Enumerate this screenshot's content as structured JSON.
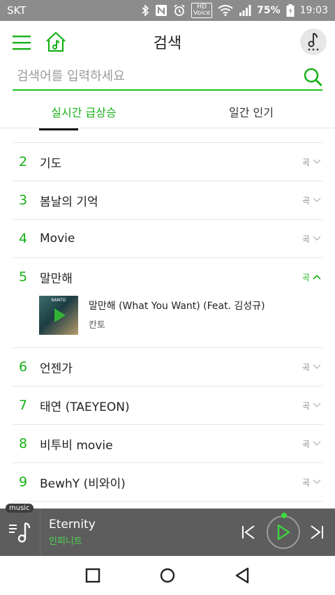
{
  "status_bar": {
    "carrier": "SKT",
    "battery": "75%",
    "time": "19:03",
    "hd_top": "HD",
    "hd_bottom": "Voice"
  },
  "header": {
    "title": "검색"
  },
  "search": {
    "placeholder": "검색어를 입력하세요"
  },
  "tabs": [
    {
      "label": "실시간 급상승",
      "active": true
    },
    {
      "label": "일간 인기",
      "active": false
    }
  ],
  "results": [
    {
      "rank": "2",
      "keyword": "기도",
      "type": "곡"
    },
    {
      "rank": "3",
      "keyword": "봄날의 기억",
      "type": "곡"
    },
    {
      "rank": "4",
      "keyword": "Movie",
      "type": "곡"
    },
    {
      "rank": "5",
      "keyword": "말만해",
      "type": "곡",
      "expanded": true
    },
    {
      "rank": "6",
      "keyword": "언젠가",
      "type": "곡"
    },
    {
      "rank": "7",
      "keyword": "태연 (TAEYEON)",
      "type": "곡"
    },
    {
      "rank": "8",
      "keyword": "비투비 movie",
      "type": "곡"
    },
    {
      "rank": "9",
      "keyword": "BewhY (비와이)",
      "type": "곡"
    }
  ],
  "expanded_song": {
    "title": "말만해 (What You Want) (Feat. 김성규)",
    "artist": "칸토",
    "album_text": "KANTO"
  },
  "player": {
    "tag": "music",
    "title": "Eternity",
    "artist": "인피니트"
  },
  "colors": {
    "accent": "#16b116",
    "player_bg": "#5d5d5d",
    "status_bg": "#8c8c8c"
  }
}
